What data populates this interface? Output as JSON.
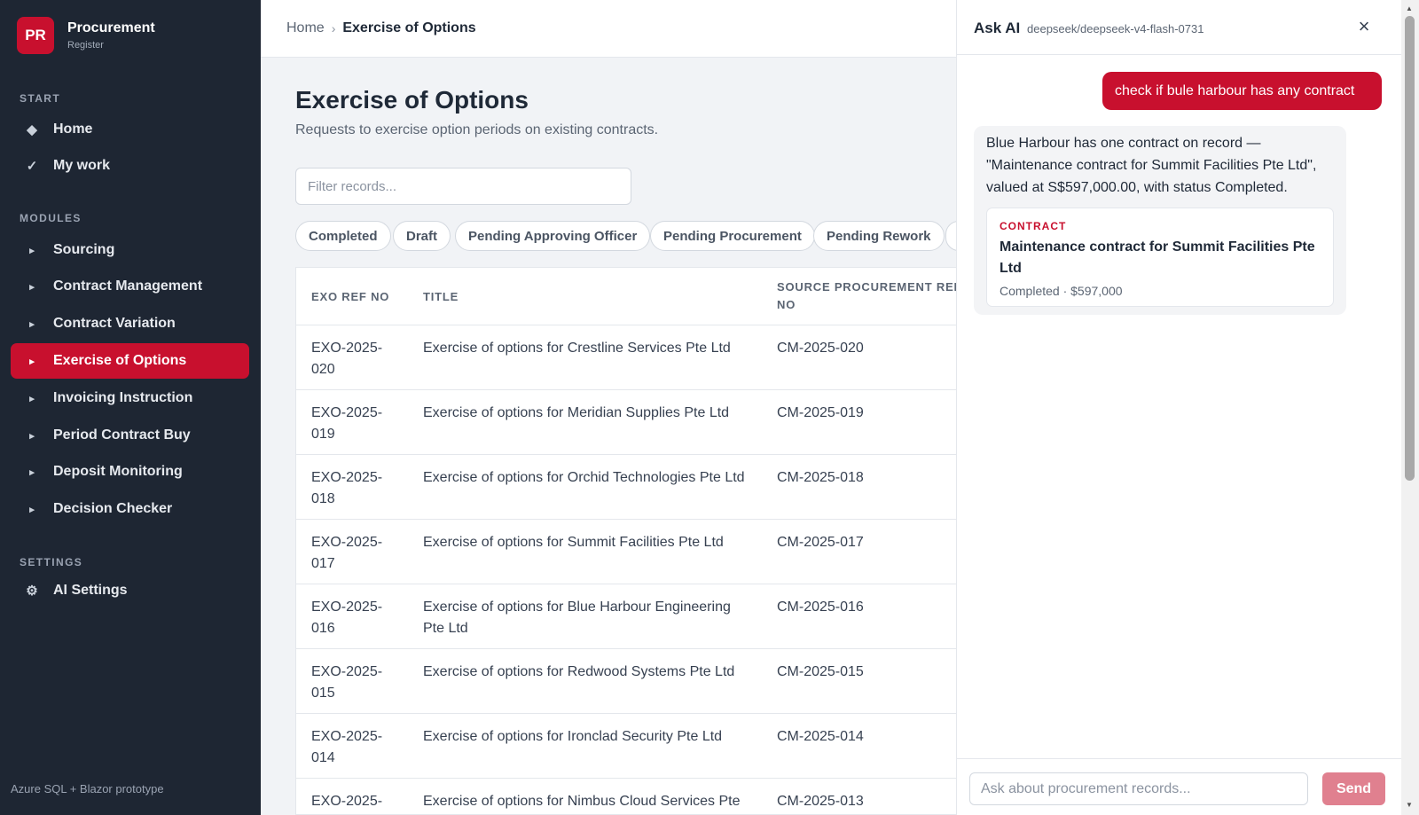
{
  "brand": {
    "logo": "PR",
    "name": "Procurement",
    "sub": "Register"
  },
  "sidebar": {
    "sections": {
      "start": "START",
      "modules": "MODULES",
      "settings": "SETTINGS"
    },
    "start_items": [
      {
        "icon": "diamond-icon",
        "glyph": "◆",
        "label": "Home"
      },
      {
        "icon": "check-icon",
        "glyph": "✓",
        "label": "My work"
      }
    ],
    "module_items": [
      {
        "label": "Sourcing",
        "glyph": "▸"
      },
      {
        "label": "Contract Management",
        "glyph": "▸"
      },
      {
        "label": "Contract Variation",
        "glyph": "▸"
      },
      {
        "label": "Exercise of Options",
        "glyph": "▸",
        "active": true
      },
      {
        "label": "Invoicing Instruction",
        "glyph": "▸"
      },
      {
        "label": "Period Contract Buy",
        "glyph": "▸"
      },
      {
        "label": "Deposit Monitoring",
        "glyph": "▸"
      },
      {
        "label": "Decision Checker",
        "glyph": "▸"
      }
    ],
    "settings_items": [
      {
        "icon": "gear-icon",
        "glyph": "⚙",
        "label": "AI Settings"
      }
    ],
    "footer": "Azure SQL + Blazor prototype"
  },
  "breadcrumb": {
    "home": "Home",
    "sep": "›",
    "current": "Exercise of Options"
  },
  "page": {
    "title": "Exercise of Options",
    "subtitle": "Requests to exercise option periods on existing contracts.",
    "filter_placeholder": "Filter records..."
  },
  "status_chips": [
    "Completed",
    "Draft",
    "Pending Approving Officer",
    "Pending Procurement",
    "Pending Rework"
  ],
  "table": {
    "headers": {
      "ref": "EXO REF NO",
      "title": "TITLE",
      "src_line1": "SOURCE PROCUREMENT REF",
      "src_line2": "NO"
    },
    "rows": [
      {
        "ref1": "EXO-2025-",
        "ref2": "020",
        "title": "Exercise of options for Crestline Services Pte Ltd",
        "src": "CM-2025-020"
      },
      {
        "ref1": "EXO-2025-",
        "ref2": "019",
        "title": "Exercise of options for Meridian Supplies Pte Ltd",
        "src": "CM-2025-019"
      },
      {
        "ref1": "EXO-2025-",
        "ref2": "018",
        "title": "Exercise of options for Orchid Technologies Pte Ltd",
        "src": "CM-2025-018"
      },
      {
        "ref1": "EXO-2025-",
        "ref2": "017",
        "title": "Exercise of options for Summit Facilities Pte Ltd",
        "src": "CM-2025-017"
      },
      {
        "ref1": "EXO-2025-",
        "ref2": "016",
        "title": "Exercise of options for Blue Harbour Engineering Pte Ltd",
        "src": "CM-2025-016"
      },
      {
        "ref1": "EXO-2025-",
        "ref2": "015",
        "title": "Exercise of options for Redwood Systems Pte Ltd",
        "src": "CM-2025-015"
      },
      {
        "ref1": "EXO-2025-",
        "ref2": "014",
        "title": "Exercise of options for Ironclad Security Pte Ltd",
        "src": "CM-2025-014"
      },
      {
        "ref1": "EXO-2025-",
        "ref2": "",
        "title": "Exercise of options for Nimbus Cloud Services Pte",
        "src": "CM-2025-013"
      }
    ]
  },
  "ai": {
    "title": "Ask AI",
    "model": "deepseek/deepseek-v4-flash-0731",
    "close": "×",
    "user_message": "check if bule harbour has any contract",
    "assistant_message": "Blue Harbour has one contract on record — \"Maintenance contract for Summit Facilities Pte Ltd\", valued at S$597,000.00, with status Completed.",
    "card": {
      "label": "CONTRACT",
      "title": "Maintenance contract for Summit Facilities Pte Ltd",
      "meta": "Completed · $597,000"
    },
    "input_placeholder": "Ask about procurement records...",
    "send_label": "Send"
  },
  "colors": {
    "accent": "#c8102e",
    "sidebar_bg": "#1e2633",
    "send_disabled": "#e0808f"
  }
}
